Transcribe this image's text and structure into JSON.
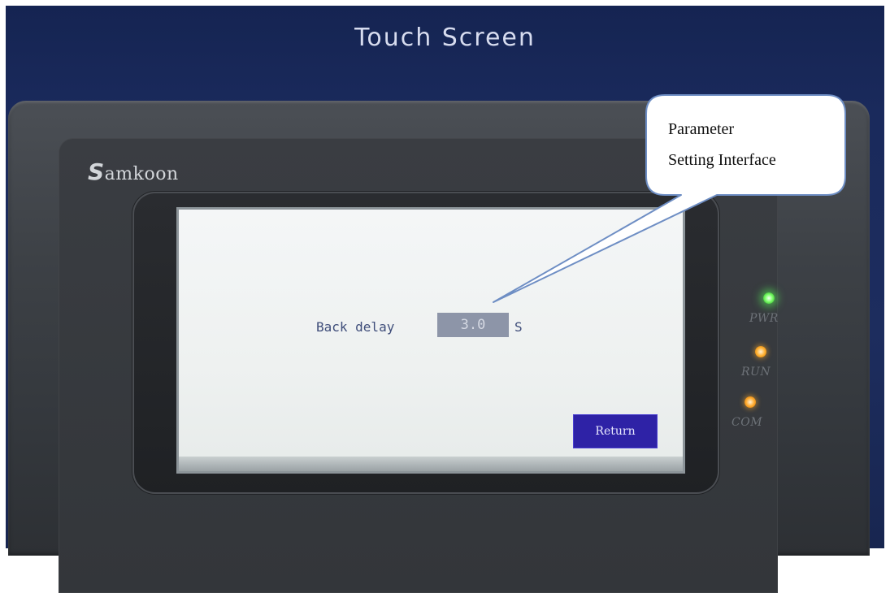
{
  "panel": {
    "title": "Touch Screen",
    "brand_initial": "S",
    "brand_rest": "amkoon"
  },
  "screen": {
    "param_label": "Back delay",
    "param_value": "3.0",
    "param_unit": "S",
    "return_label": "Return"
  },
  "indicators": [
    {
      "label": "PWR",
      "color": "#6cff5a"
    },
    {
      "label": "RUN",
      "color": "#ffa62b"
    },
    {
      "label": "COM",
      "color": "#ffa62b"
    }
  ],
  "callout": {
    "line1": "Parameter",
    "line2": "Setting Interface"
  }
}
